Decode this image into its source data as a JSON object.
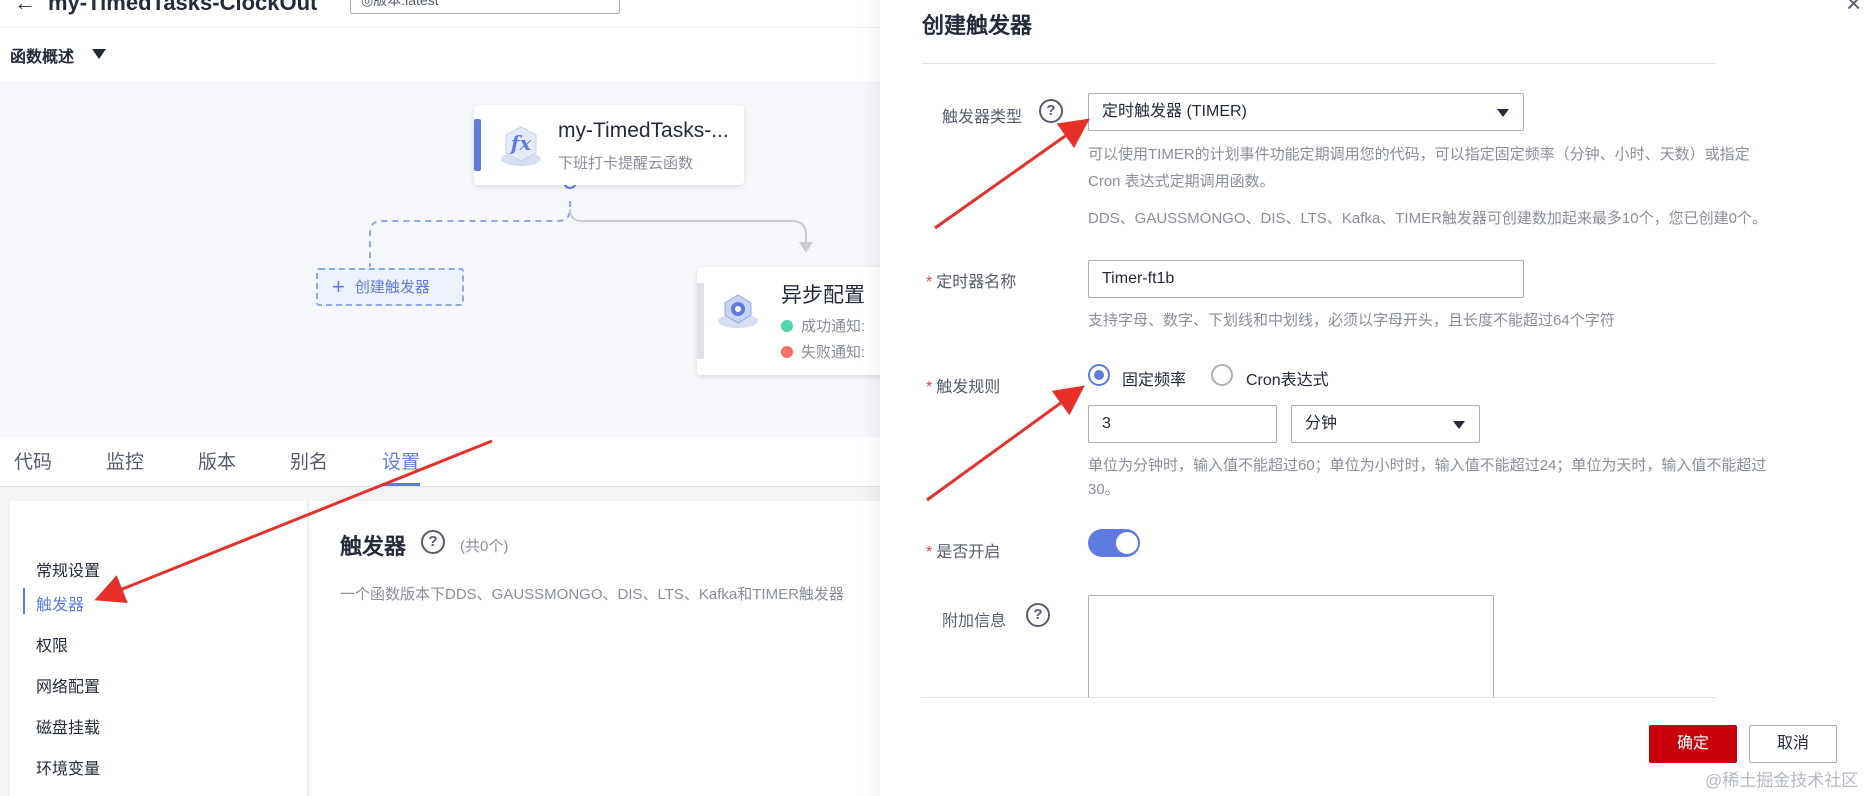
{
  "header": {
    "back_arrow": "←",
    "function_title": "my-TimedTasks-ClockOut",
    "version_select": "◎版本:latest"
  },
  "overview": {
    "label": "函数概述"
  },
  "canvas": {
    "function_card": {
      "name": "my-TimedTasks-...",
      "description": "下班打卡提醒云函数"
    },
    "create_trigger_label": "创建触发器",
    "async_card": {
      "title": "异步配置",
      "success_label": "成功通知:",
      "failure_label": "失败通知:"
    }
  },
  "tabs": [
    {
      "label": "代码"
    },
    {
      "label": "监控"
    },
    {
      "label": "版本"
    },
    {
      "label": "别名"
    },
    {
      "label": "设置",
      "active": true
    }
  ],
  "side_menu": [
    {
      "label": "常规设置"
    },
    {
      "label": "触发器",
      "active": true
    },
    {
      "label": "权限"
    },
    {
      "label": "网络配置"
    },
    {
      "label": "磁盘挂载"
    },
    {
      "label": "环境变量"
    }
  ],
  "trigger_panel": {
    "heading": "触发器",
    "help": "?",
    "count": "(共0个)",
    "description": "一个函数版本下DDS、GAUSSMONGO、DIS、LTS、Kafka和TIMER触发器"
  },
  "drawer": {
    "title": "创建触发器",
    "close": "×",
    "trigger_type": {
      "label": "触发器类型",
      "value": "定时触发器 (TIMER)",
      "hint_line1": "可以使用TIMER的计划事件功能定期调用您的代码，可以指定固定频率（分钟、小时、天数）或指定",
      "hint_line2": "Cron 表达式定期调用函数。",
      "hint_line3": "DDS、GAUSSMONGO、DIS、LTS、Kafka、TIMER触发器可创建数加起来最多10个，您已创建0个。"
    },
    "timer_name": {
      "required_mark": "*",
      "label": "定时器名称",
      "value": "Timer-ft1b",
      "hint": "支持字母、数字、下划线和中划线，必须以字母开头，且长度不能超过64个字符"
    },
    "trigger_rule": {
      "required_mark": "*",
      "label": "触发规则",
      "option_fixed": "固定频率",
      "option_cron": "Cron表达式",
      "selected": "固定频率",
      "amount": "3",
      "unit": "分钟",
      "hint_line1": "单位为分钟时，输入值不能超过60；单位为小时时，输入值不能超过24；单位为天时，输入值不能超过",
      "hint_line2": "30。"
    },
    "enabled": {
      "required_mark": "*",
      "label": "是否开启",
      "value": true
    },
    "extra_info": {
      "label": "附加信息",
      "help": "?",
      "value": ""
    },
    "confirm_label": "确定",
    "cancel_label": "取消"
  },
  "watermark": "@稀土掘金技术社区",
  "colors": {
    "accent": "#5e7ce0",
    "primary_button": "#c7000b",
    "annotation_arrow": "#e8302a",
    "success_dot": "#50d4ab",
    "failure_dot": "#f66f6a"
  }
}
